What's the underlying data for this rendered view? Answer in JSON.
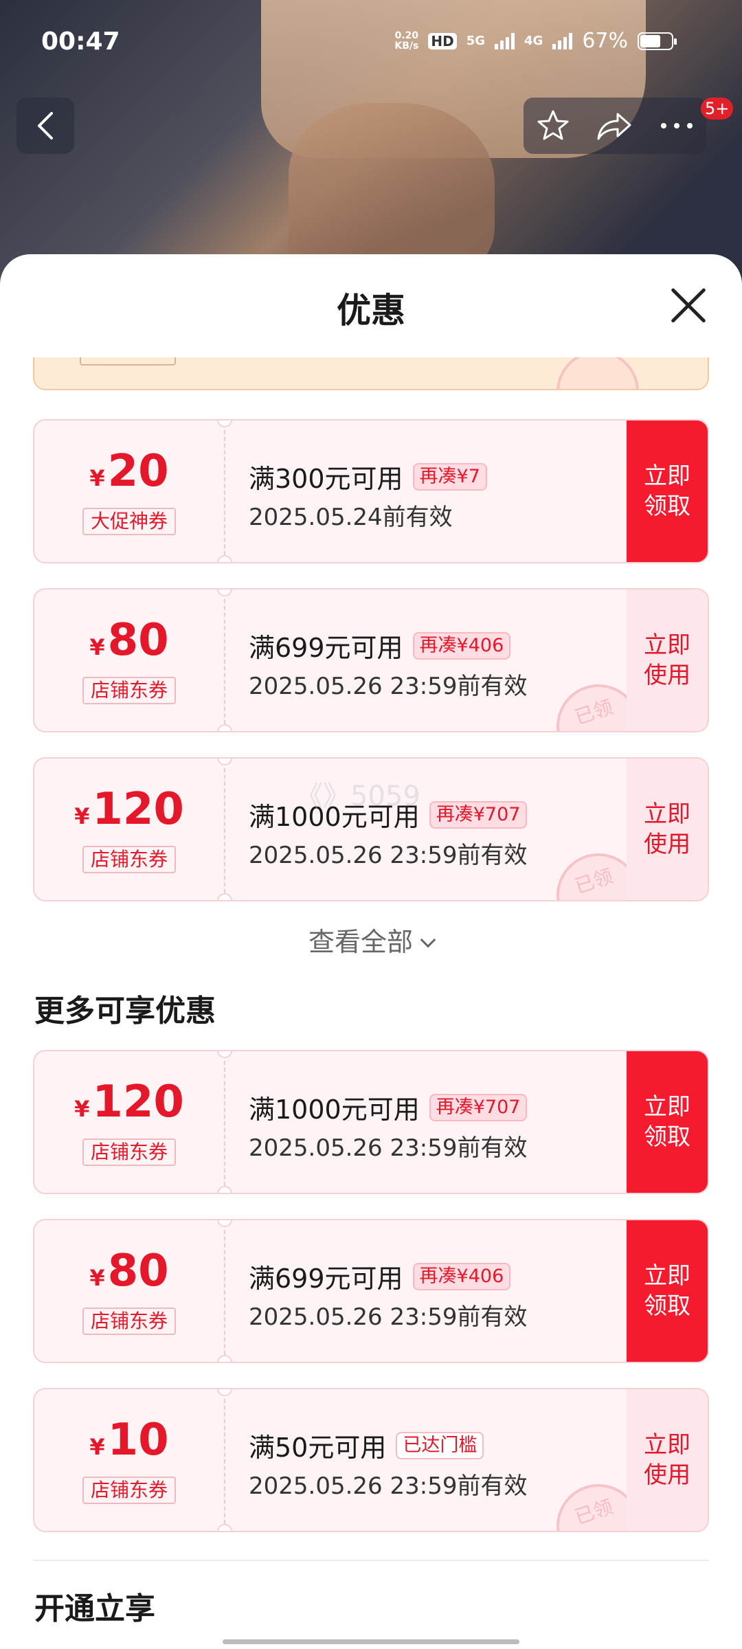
{
  "status_bar": {
    "time": "00:47",
    "net_speed_value": "0.20",
    "net_speed_unit": "KB/s",
    "hd_label": "HD",
    "sim1_network": "5G",
    "sim2_network": "4G",
    "battery_percent": "67%",
    "battery_level": 0.67
  },
  "nav": {
    "notification_badge": "5+"
  },
  "sheet": {
    "title": "优惠"
  },
  "coupons": [
    {
      "yen": "¥",
      "amount": "20",
      "type": "大促神券",
      "condition": "满300元可用",
      "pill": "再凑¥7",
      "valid": "2025.05.24前有效",
      "action": "立即\n领取",
      "action_style": "claim",
      "claimed_stamp": ""
    },
    {
      "yen": "¥",
      "amount": "80",
      "type": "店铺东券",
      "condition": "满699元可用",
      "pill": "再凑¥406",
      "valid": "2025.05.26 23:59前有效",
      "action": "立即\n使用",
      "action_style": "use",
      "claimed_stamp": "已领"
    },
    {
      "yen": "¥",
      "amount": "120",
      "type": "店铺东券",
      "condition": "满1000元可用",
      "pill": "再凑¥707",
      "valid": "2025.05.26 23:59前有效",
      "action": "立即\n使用",
      "action_style": "use",
      "claimed_stamp": "已领"
    }
  ],
  "view_all": "查看全部",
  "more_section": {
    "title": "更多可享优惠",
    "coupons": [
      {
        "yen": "¥",
        "amount": "120",
        "type": "店铺东券",
        "condition": "满1000元可用",
        "pill": "再凑¥707",
        "valid": "2025.05.26 23:59前有效",
        "action": "立即\n领取",
        "action_style": "claim",
        "claimed_stamp": ""
      },
      {
        "yen": "¥",
        "amount": "80",
        "type": "店铺东券",
        "condition": "满699元可用",
        "pill": "再凑¥406",
        "valid": "2025.05.26 23:59前有效",
        "action": "立即\n领取",
        "action_style": "claim",
        "claimed_stamp": ""
      },
      {
        "yen": "¥",
        "amount": "10",
        "type": "店铺东券",
        "condition": "满50元可用",
        "pill": "已达门槛",
        "valid": "2025.05.26 23:59前有效",
        "action": "立即\n使用",
        "action_style": "use",
        "claimed_stamp": "已领"
      }
    ]
  },
  "open_section": {
    "title": "开通立享"
  },
  "colors": {
    "accent": "#f51a2e",
    "price_red": "#e5172a",
    "coupon_bg": "#fff4f5"
  }
}
